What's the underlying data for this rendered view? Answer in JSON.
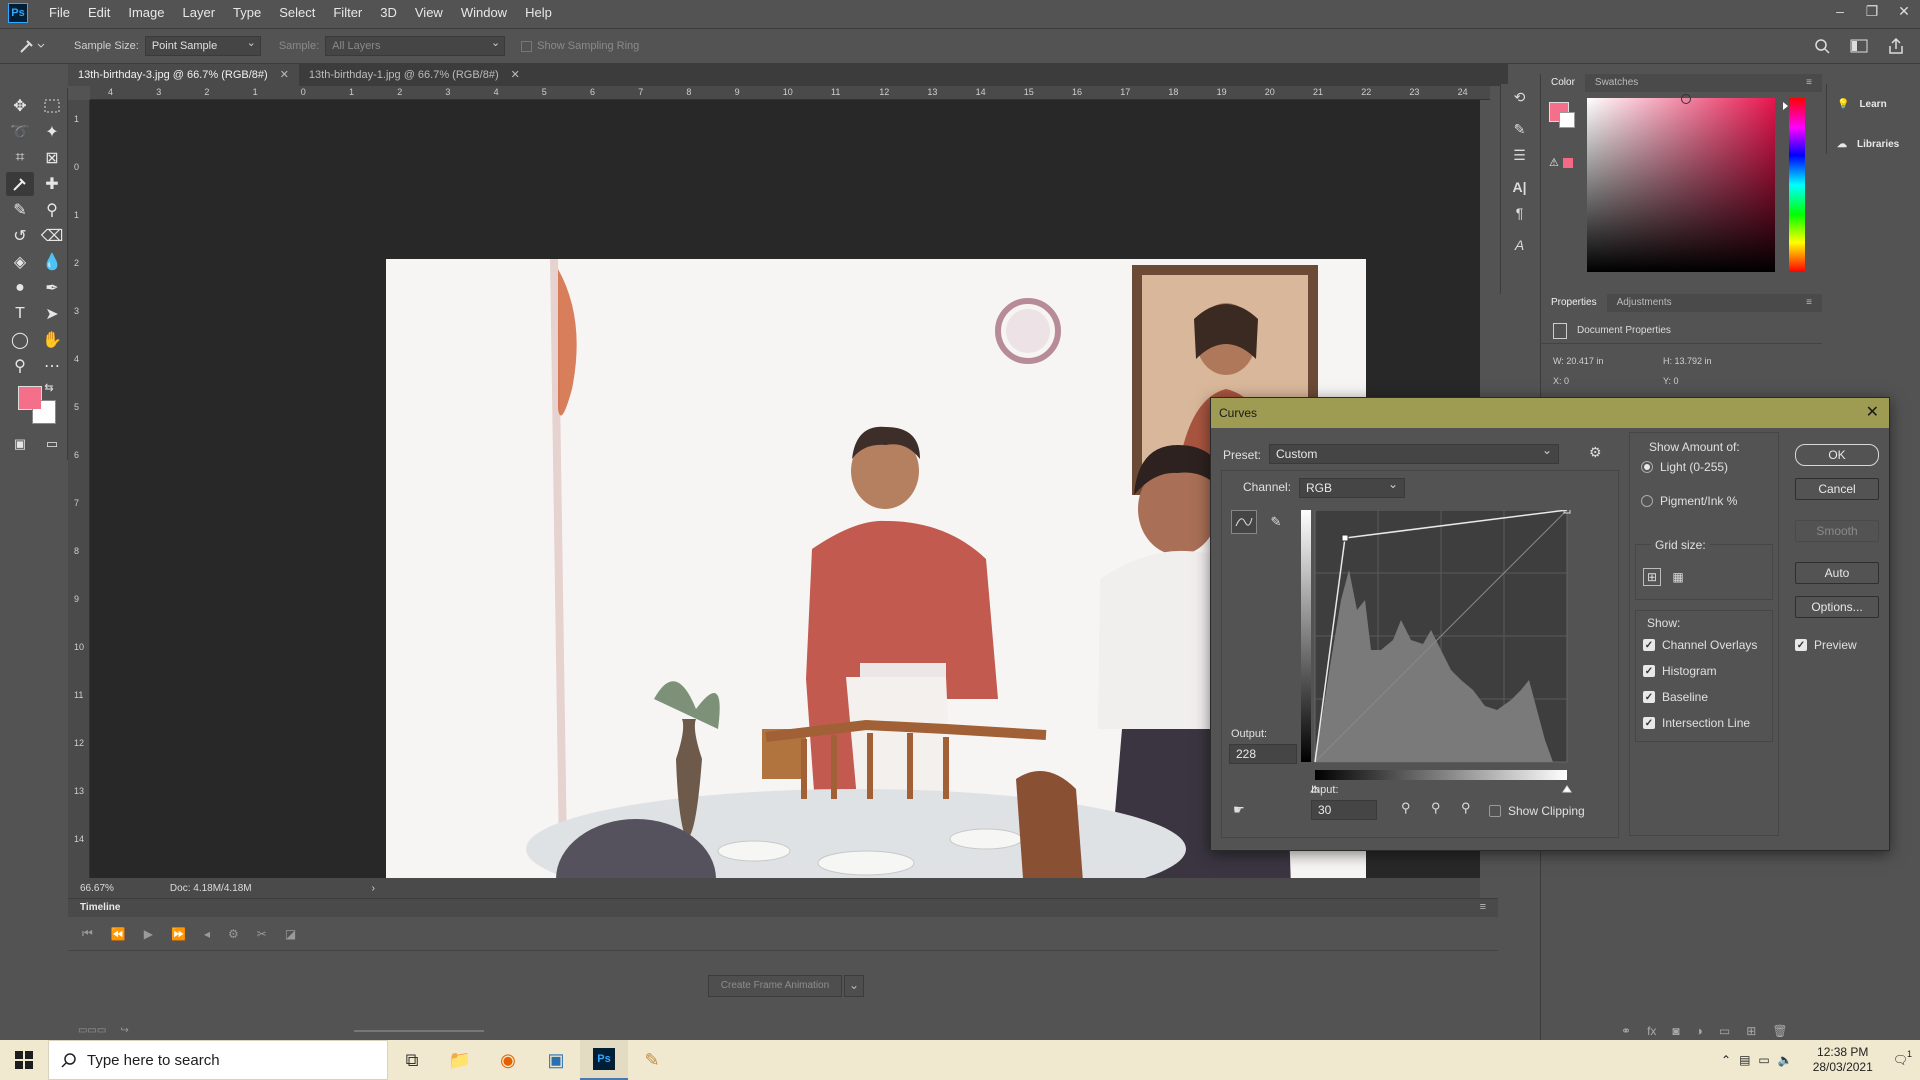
{
  "menubar": {
    "logo": "Ps",
    "items": [
      "File",
      "Edit",
      "Image",
      "Layer",
      "Type",
      "Select",
      "Filter",
      "3D",
      "View",
      "Window",
      "Help"
    ],
    "controls": [
      "–",
      "❐",
      "✕"
    ]
  },
  "options_bar": {
    "sample_size_label": "Sample Size:",
    "sample_size_value": "Point Sample",
    "sample_label": "Sample:",
    "sample_value": "All Layers",
    "sampling_ring_label": "Show Sampling Ring"
  },
  "doc_tabs": [
    {
      "label": "13th-birthday-3.jpg @ 66.7% (RGB/8#)",
      "active": true
    },
    {
      "label": "13th-birthday-1.jpg @ 66.7% (RGB/8#)",
      "active": false
    }
  ],
  "ruler_h": [
    "4",
    "3",
    "2",
    "1",
    "0",
    "1",
    "2",
    "3",
    "4",
    "5",
    "6",
    "7",
    "8",
    "9",
    "10",
    "11",
    "12",
    "13",
    "14",
    "15",
    "16",
    "17",
    "18",
    "19",
    "20",
    "21",
    "22",
    "23",
    "24"
  ],
  "ruler_v": [
    "1",
    "0",
    "1",
    "2",
    "3",
    "4",
    "5",
    "6",
    "7",
    "8",
    "9",
    "10",
    "11",
    "12",
    "13",
    "14"
  ],
  "status": {
    "zoom": "66.67%",
    "doc": "Doc: 4.18M/4.18M",
    "arrow": "›"
  },
  "timeline": {
    "title": "Timeline",
    "create_frame": "Create Frame Animation"
  },
  "color_panel": {
    "tabs": [
      "Color",
      "Swatches"
    ],
    "fg": "#f4708a",
    "bg": "#ffffff"
  },
  "properties": {
    "tabs": [
      "Properties",
      "Adjustments"
    ],
    "doc_props": "Document Properties",
    "w": "W:  20.417 in",
    "h": "H:  13.792 in",
    "x": "X:  0",
    "y": "Y:  0"
  },
  "learn_libraries": {
    "learn": "Learn",
    "libraries": "Libraries"
  },
  "curves": {
    "title": "Curves",
    "preset_label": "Preset:",
    "preset_value": "Custom",
    "channel_label": "Channel:",
    "channel_value": "RGB",
    "output_label": "Output:",
    "output_value": "228",
    "input_label": "Input:",
    "input_value": "30",
    "show_clipping": "Show Clipping",
    "show_amount_label": "Show Amount of:",
    "light": "Light  (0-255)",
    "pigment": "Pigment/Ink %",
    "grid_size_label": "Grid size:",
    "show_label": "Show:",
    "channel_overlays": "Channel Overlays",
    "histogram": "Histogram",
    "baseline": "Baseline",
    "intersection_line": "Intersection Line",
    "buttons": {
      "ok": "OK",
      "cancel": "Cancel",
      "smooth": "Smooth",
      "auto": "Auto",
      "options": "Options..."
    },
    "preview": "Preview"
  },
  "taskbar": {
    "search_placeholder": "Type here to search",
    "time": "12:38 PM",
    "date": "28/03/2021",
    "notif": "1"
  }
}
